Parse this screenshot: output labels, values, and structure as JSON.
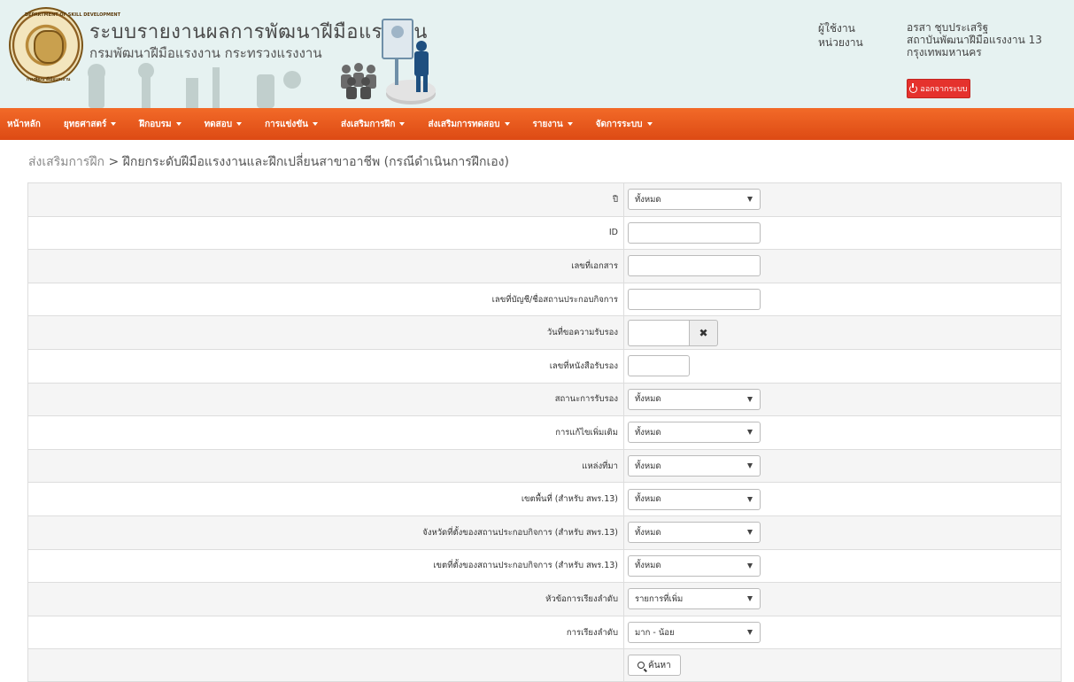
{
  "header": {
    "title": "ระบบรายงานผลการพัฒนาฝีมือแรงงาน",
    "subtitle": "กรมพัฒนาฝีมือแรงงาน กระทรวงแรงงาน",
    "seal_text_top": "DEPARTMENT OF SKILL DEVELOPMENT",
    "seal_text_bottom": "กรมพัฒนาฝีมือแรงงาน",
    "user_label": "ผู้ใช้งาน",
    "unit_label": "หน่วยงาน",
    "user_name": "อรสา ชุบประเสริฐ",
    "unit_name_line1": "สถาบันพัฒนาฝีมือแรงงาน 13",
    "unit_name_line2": "กรุงเทพมหานคร",
    "logout_label": "ออกจากระบบ"
  },
  "nav": {
    "items": [
      {
        "label": "หน้าหลัก",
        "dropdown": false
      },
      {
        "label": "ยุทธศาสตร์",
        "dropdown": true
      },
      {
        "label": "ฝึกอบรม",
        "dropdown": true
      },
      {
        "label": "ทดสอบ",
        "dropdown": true
      },
      {
        "label": "การแข่งขัน",
        "dropdown": true
      },
      {
        "label": "ส่งเสริมการฝึก",
        "dropdown": true
      },
      {
        "label": "ส่งเสริมการทดสอบ",
        "dropdown": true
      },
      {
        "label": "รายงาน",
        "dropdown": true
      },
      {
        "label": "จัดการระบบ",
        "dropdown": true
      }
    ]
  },
  "breadcrumb": {
    "parent": "ส่งเสริมการฝึก",
    "separator": " > ",
    "current": "ฝึกยกระดับฝีมือแรงงานและฝึกเปลี่ยนสาขาอาชีพ (กรณีดำเนินการฝึกเอง)"
  },
  "form": {
    "year": {
      "label": "ปี",
      "value": "ทั้งหมด"
    },
    "id": {
      "label": "ID",
      "value": ""
    },
    "doc_no": {
      "label": "เลขที่เอกสาร",
      "value": ""
    },
    "account_no": {
      "label": "เลขที่บัญชี/ชื่อสถานประกอบกิจการ",
      "value": ""
    },
    "request_date": {
      "label": "วันที่ขอความรับรอง",
      "value": ""
    },
    "cert_no": {
      "label": "เลขที่หนังสือรับรอง",
      "value": ""
    },
    "cert_status": {
      "label": "สถานะการรับรอง",
      "value": "ทั้งหมด"
    },
    "amendment": {
      "label": "การแก้ไขเพิ่มเติม",
      "value": "ทั้งหมด"
    },
    "source": {
      "label": "แหล่งที่มา",
      "value": "ทั้งหมด"
    },
    "zone": {
      "label": "เขตพื้นที่ (สำหรับ สพร.13)",
      "value": "ทั้งหมด"
    },
    "province": {
      "label": "จังหวัดที่ตั้งของสถานประกอบกิจการ (สำหรับ สพร.13)",
      "value": "ทั้งหมด"
    },
    "district": {
      "label": "เขตที่ตั้งของสถานประกอบกิจการ (สำหรับ สพร.13)",
      "value": "ทั้งหมด"
    },
    "sort_by": {
      "label": "หัวข้อการเรียงลำดับ",
      "value": "รายการที่เพิ่ม"
    },
    "sort_order": {
      "label": "การเรียงลำดับ",
      "value": "มาก - น้อย"
    },
    "clear_symbol": "✖",
    "search_label": "ค้นหา"
  },
  "colors": {
    "nav_orange": "#e8541c",
    "header_bg": "#e6f2f1",
    "logout_red": "#e5322d"
  }
}
